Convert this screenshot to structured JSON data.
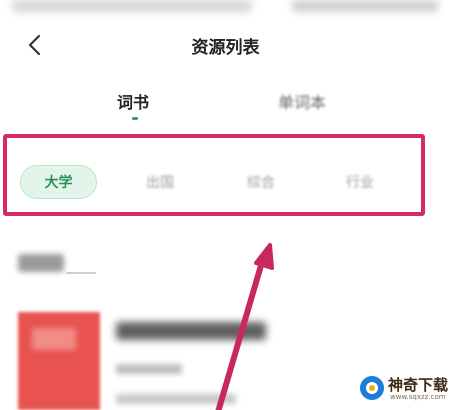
{
  "header": {
    "title": "资源列表",
    "back_icon": "chevron-left-icon"
  },
  "tabs": [
    {
      "label": "词书",
      "active": true
    },
    {
      "label": "单词本",
      "active": false
    }
  ],
  "categories": [
    {
      "label": "大学",
      "active": true
    },
    {
      "label": "出国",
      "active": false
    },
    {
      "label": "综合",
      "active": false
    },
    {
      "label": "行业",
      "active": false
    }
  ],
  "colors": {
    "accent": "#2e9e6a",
    "annotation": "#d6296c",
    "book_cover": "#e8524f"
  },
  "watermark": {
    "name": "神奇下载",
    "url": "www.sqxzz.com"
  }
}
